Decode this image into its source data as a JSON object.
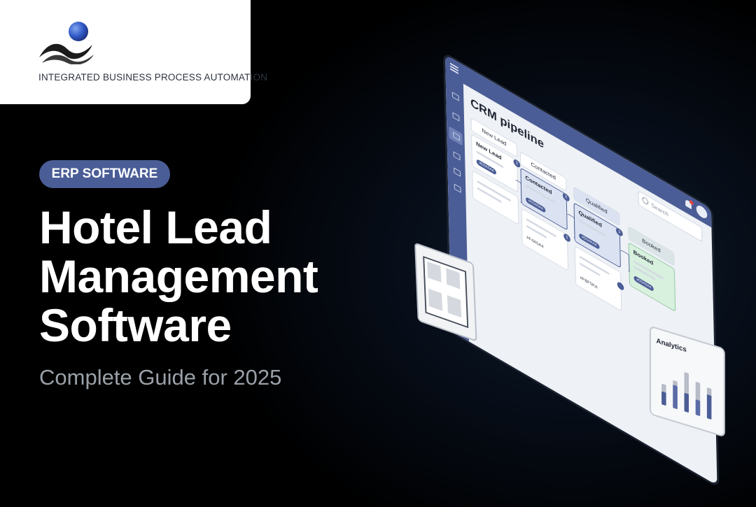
{
  "brand": {
    "tagline": "INTEGRATED BUSINESS PROCESS AUTOMATION",
    "accent": "#4a5d96",
    "logo_ball_color": "#2f57c4"
  },
  "hero": {
    "category_pill": "ERP SOFTWARE",
    "title_lines": [
      "Hotel Lead",
      "Management",
      "Software"
    ],
    "subtitle": "Complete Guide for 2025"
  },
  "crm_screen": {
    "title": "CRM pipeline",
    "search_placeholder": "Search",
    "sidebar_icons": [
      "menu-icon",
      "logo-icon",
      "book-icon",
      "pipeline-icon",
      "contacts-icon",
      "calendar-icon",
      "settings-icon"
    ],
    "columns": [
      {
        "header": "New Lead",
        "cards": [
          {
            "title": "New Lead",
            "badge": "1",
            "tag": "#D5A5A4"
          },
          {
            "title": "",
            "badge": "",
            "tag": ""
          }
        ]
      },
      {
        "header": "Contacted",
        "cards": [
          {
            "title": "Contacted",
            "badge": "2",
            "tag": "#C5A5A4"
          },
          {
            "title": "",
            "badge": "1",
            "code": "#F4A5A4"
          }
        ]
      },
      {
        "header": "Qualified",
        "cards": [
          {
            "title": "Qualified",
            "badge": "1",
            "tag": "#D5AKA4"
          },
          {
            "title": "",
            "badge": "",
            "code": "#FBF5KA"
          }
        ]
      },
      {
        "header": "Booked",
        "cards": [
          {
            "title": "Booked",
            "badge": "",
            "tag": "#D5A5A4"
          }
        ]
      }
    ],
    "has_notification": true
  },
  "floorplan_card": {
    "icon": "floorplan-icon"
  },
  "analytics_card": {
    "title": "Analytics",
    "bars": [
      {
        "gray": 0.45,
        "blue": 0.28
      },
      {
        "gray": 0.6,
        "blue": 0.5
      },
      {
        "gray": 0.85,
        "blue": 0.4
      },
      {
        "gray": 0.72,
        "blue": 0.34
      },
      {
        "gray": 0.66,
        "blue": 0.52
      }
    ]
  }
}
